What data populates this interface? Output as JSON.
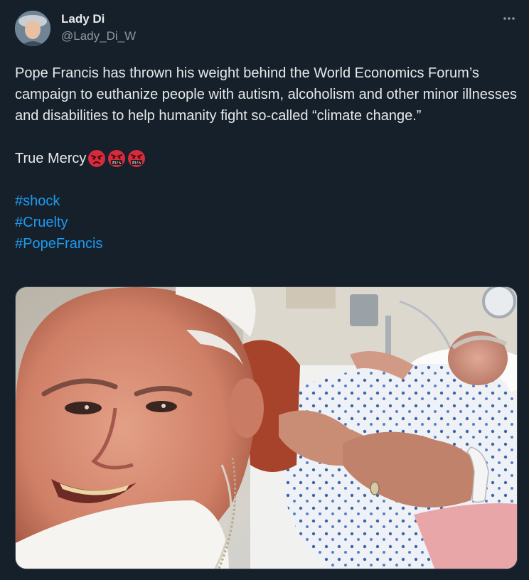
{
  "author": {
    "display_name": "Lady Di",
    "handle": "@Lady_Di_W"
  },
  "more_icon": "more-horizontal-icon",
  "tweet": {
    "paragraph": "Pope Francis has thrown his weight behind the World Economics Forum’s campaign to euthanize people with autism, alcoholism and other minor illnesses and disabilities to help humanity fight so-called “climate change.”",
    "mercy_text": "True Mercy",
    "emojis": [
      "pouting-face-emoji",
      "face-with-symbols-on-mouth-emoji",
      "face-with-symbols-on-mouth-emoji"
    ],
    "emoji_symbol_text": "#$!&",
    "hashtags": [
      "#shock",
      "#Cruelty",
      "#PopeFrancis"
    ]
  },
  "colors": {
    "background": "#15202b",
    "text": "#e7e9ea",
    "secondary": "#8b98a5",
    "link": "#1d9bf0",
    "emoji_red": "#d62b3c"
  }
}
